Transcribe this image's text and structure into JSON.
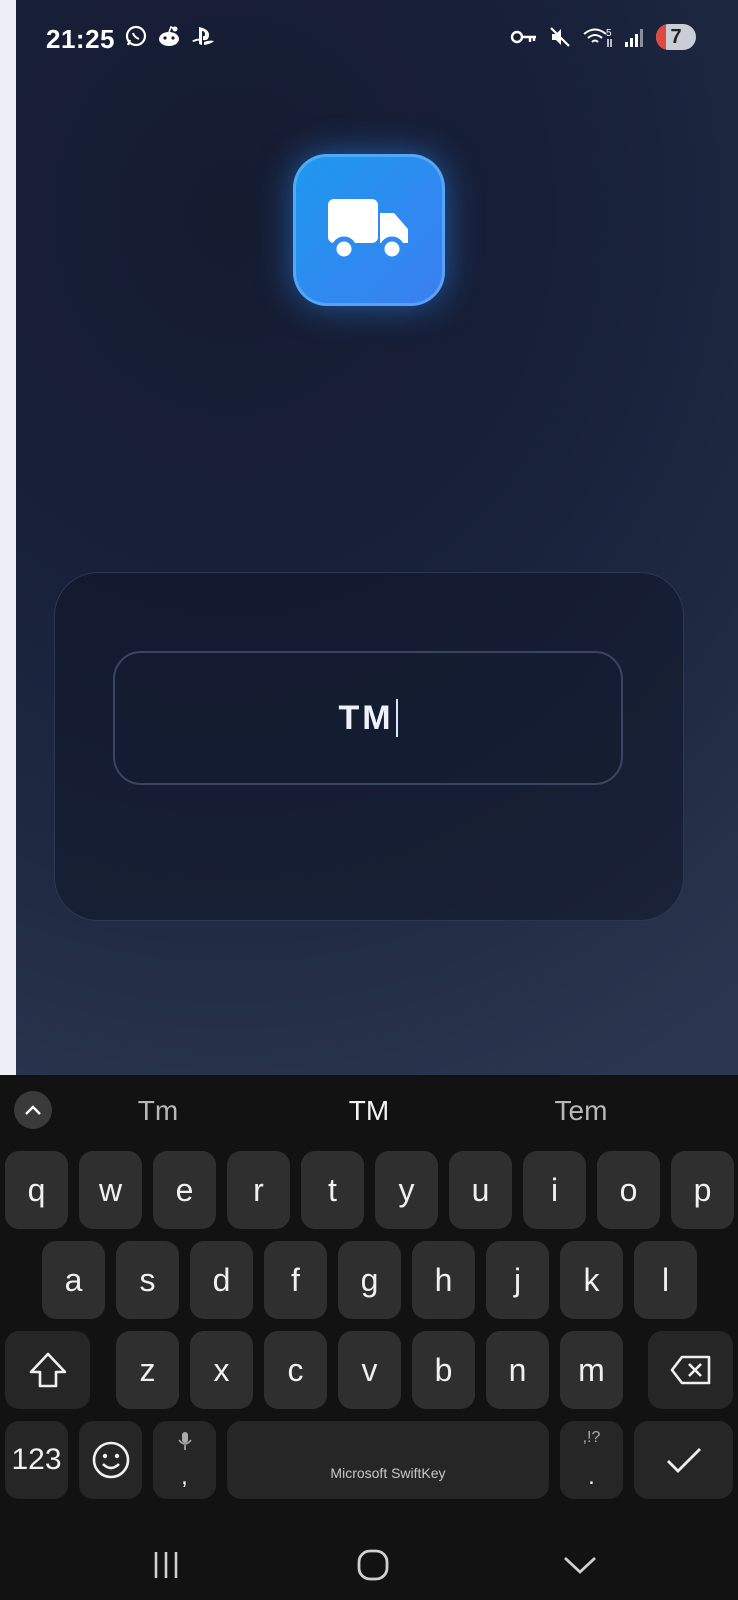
{
  "status_bar": {
    "time": "21:25",
    "battery": "7"
  },
  "form": {
    "code_value": "TM"
  },
  "keyboard": {
    "suggestions": [
      "Tm",
      "TM",
      "Tem"
    ],
    "row1": [
      "q",
      "w",
      "e",
      "r",
      "t",
      "y",
      "u",
      "i",
      "o",
      "p"
    ],
    "row2": [
      "a",
      "s",
      "d",
      "f",
      "g",
      "h",
      "j",
      "k",
      "l"
    ],
    "row3": [
      "z",
      "x",
      "c",
      "v",
      "b",
      "n",
      "m"
    ],
    "numbers_label": "123",
    "comma": ",",
    "space_label": "Microsoft SwiftKey",
    "period_hint": ",!?",
    "period": "."
  }
}
